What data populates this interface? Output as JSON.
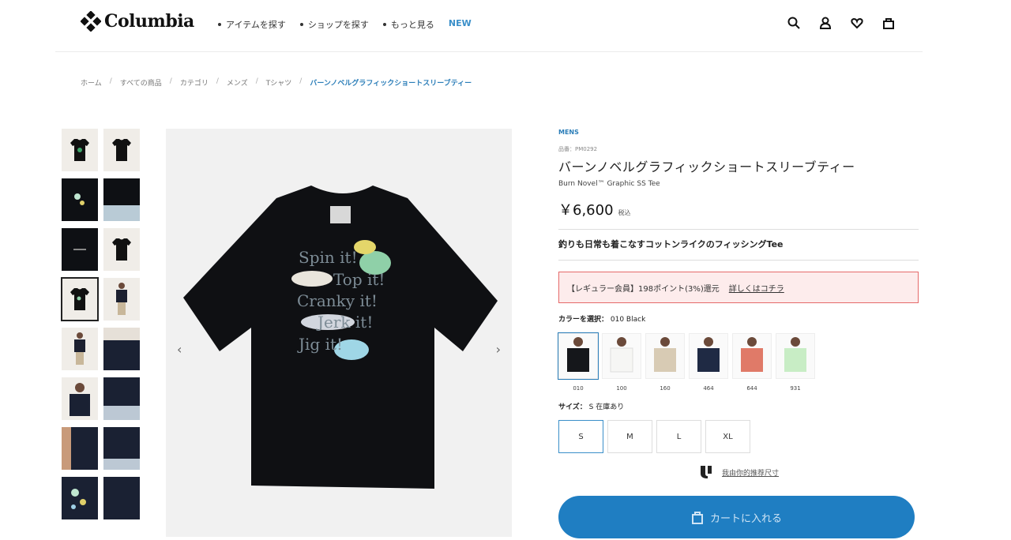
{
  "header": {
    "logo_text": "Columbia",
    "nav": [
      "アイテムを探す",
      "ショップを探す",
      "もっと見る"
    ],
    "nav_new": "NEW",
    "icons": [
      "search-icon",
      "account-icon",
      "heart-icon",
      "bag-icon"
    ]
  },
  "breadcrumb": [
    "ホーム",
    "すべての商品",
    "カテゴリ",
    "メンズ",
    "Tシャツ",
    "バーンノベルグラフィックショートスリーブティー"
  ],
  "gallery": {
    "thumb_count": 16,
    "selected_index": 6,
    "main_print": [
      "Spin it!",
      "Top it!",
      "Cranky it!",
      "Jerk it!",
      "Jig it!"
    ],
    "prev_arrow": "‹",
    "next_arrow": "›"
  },
  "product": {
    "category": "MENS",
    "code": "品番：PM0292",
    "title": "バーンノベルグラフィックショートスリーブティー",
    "subtitle": "Burn Novel™ Graphic SS Tee",
    "price": "￥6,600",
    "tax": "税込",
    "catchcopy": "釣りも日常も着こなすコットンライクのフィッシングTee",
    "member_text": "【レギュラー会員】198ポイント(3%)還元",
    "member_link": "詳しくはコチラ",
    "color_label": "カラーを選択：",
    "color_selected": "010 Black",
    "colors": [
      {
        "code": "010",
        "hex": "#15171b"
      },
      {
        "code": "100",
        "hex": "#f6f6f4"
      },
      {
        "code": "160",
        "hex": "#d8cbb4"
      },
      {
        "code": "464",
        "hex": "#1f2a44"
      },
      {
        "code": "644",
        "hex": "#e07a68"
      },
      {
        "code": "931",
        "hex": "#c8edc5"
      }
    ],
    "size_label": "サイズ：",
    "size_selected": "S",
    "stock": "在庫あり",
    "sizes": [
      "S",
      "M",
      "L",
      "XL"
    ],
    "recommend_text": "我由你的推荐尺寸",
    "cart_label": "カートに入れる"
  },
  "accent_color": "#1f7ec2"
}
